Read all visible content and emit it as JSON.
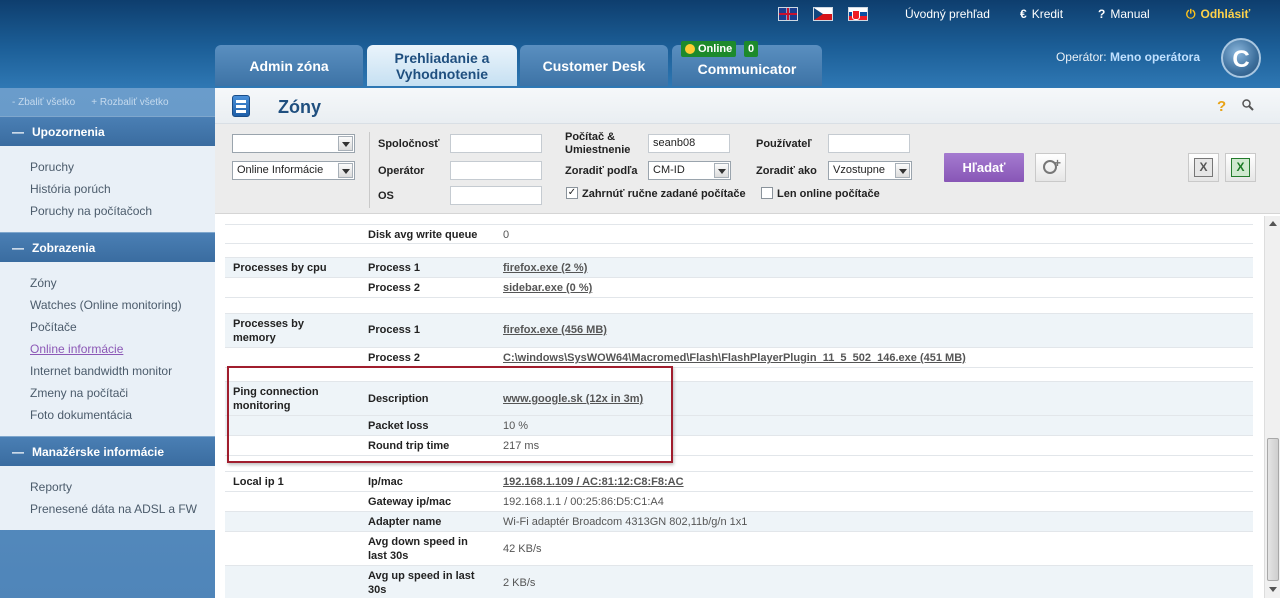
{
  "header": {
    "links": {
      "home": "Úvodný prehľad",
      "credit": "Kredit",
      "manual": "Manual",
      "logout": "Odhlásiť"
    },
    "icons": {
      "credit": "€",
      "manual": "?",
      "logout": "⏻"
    },
    "tabs": {
      "admin": "Admin zóna",
      "review_line1": "Prehliadanie a",
      "review_line2": "Vyhodnotenie",
      "customer": "Customer Desk",
      "communicator": "Communicator"
    },
    "online_badge": "Online",
    "online_count": "0",
    "operator_label": "Operátor:",
    "operator_name": "Meno operátora",
    "logo_letter": "C"
  },
  "sidebar": {
    "collapse_all": "Zbaliť všetko",
    "expand_all": "Rozbaliť všetko",
    "sections": {
      "alerts": {
        "title": "Upozornenia",
        "items": [
          "Poruchy",
          "História porúch",
          "Poruchy na počítačoch"
        ]
      },
      "views": {
        "title": "Zobrazenia",
        "items": [
          "Zóny",
          "Watches (Online monitoring)",
          "Počítače",
          "Online informácie",
          "Internet bandwidth monitor",
          "Zmeny na počítači",
          "Foto dokumentácia"
        ]
      },
      "management": {
        "title": "Manažérske informácie",
        "items": [
          "Reporty",
          "Prenesené dáta na ADSL a FW"
        ]
      }
    }
  },
  "page": {
    "title": "Zóny",
    "help_icon": "?"
  },
  "filters": {
    "select1_value": "",
    "select2_value": "Online Informácie",
    "company_label": "Spoločnosť",
    "operator_label": "Operátor",
    "os_label": "OS",
    "computer_label_line1": "Počítač &",
    "computer_label_line2": "Umiestnenie",
    "computer_value": "seanb08",
    "sort_by_label": "Zoradiť podľa",
    "sort_by_value": "CM-ID",
    "user_label": "Používateľ",
    "sort_order_label": "Zoradiť ako",
    "sort_order_value": "Vzostupne",
    "include_manual_label": "Zahrnúť ručne zadané počítače",
    "include_manual_checked": "✓",
    "online_only_label": "Len online počítače",
    "search_button": "Hľadať",
    "xls_label": "X"
  },
  "table": {
    "disk_queue_key": "Disk avg write queue",
    "disk_queue_val": "0",
    "cpu_section": "Processes by cpu",
    "cpu_p1_key": "Process 1",
    "cpu_p1_val": "firefox.exe (2 %)",
    "cpu_p2_key": "Process 2",
    "cpu_p2_val": "sidebar.exe (0 %)",
    "mem_section_line1": "Processes by",
    "mem_section_line2": "memory",
    "mem_p1_key": "Process 1",
    "mem_p1_val": "firefox.exe (456 MB)",
    "mem_p2_key": "Process 2",
    "mem_p2_val": "C:\\windows\\SysWOW64\\Macromed\\Flash\\FlashPlayerPlugin_11_5_502_146.exe (451 MB)",
    "ping_section_line1": "Ping connection",
    "ping_section_line2": "monitoring",
    "ping_desc_key": "Description",
    "ping_desc_val": "www.google.sk (12x in 3m)",
    "ping_loss_key": "Packet loss",
    "ping_loss_val": "10 %",
    "ping_rtt_key": "Round trip time",
    "ping_rtt_val": "217 ms",
    "ip_section": "Local ip 1",
    "ipmac_key": "Ip/mac",
    "ipmac_val": "192.168.1.109 / AC:81:12:C8:F8:AC",
    "gateway_key": "Gateway ip/mac",
    "gateway_val": "192.168.1.1 / 00:25:86:D5:C1:A4",
    "adapter_key": "Adapter name",
    "adapter_val": "Wi-Fi adaptér Broadcom 4313GN 802,11b/g/n 1x1",
    "down_key_line1": "Avg down speed in",
    "down_key_line2": "last 30s",
    "down_val": "42 KB/s",
    "up_key_line1": "Avg up speed in last",
    "up_key_line2": "30s",
    "up_val": "2 KB/s"
  },
  "colors": {
    "accent": "#8856b6",
    "highlight_box": "#a01d2d",
    "header": "#1c5f98"
  }
}
